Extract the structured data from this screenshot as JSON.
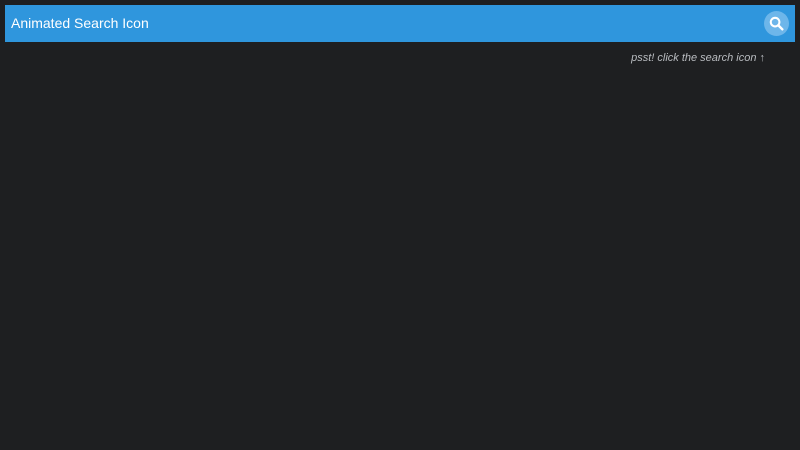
{
  "header": {
    "title": "Animated Search Icon",
    "search_icon": "search-icon",
    "background_color": "#2f96dd"
  },
  "hint": {
    "text": "psst! click the search icon ↑"
  },
  "page": {
    "background_color": "#1e1f21"
  }
}
